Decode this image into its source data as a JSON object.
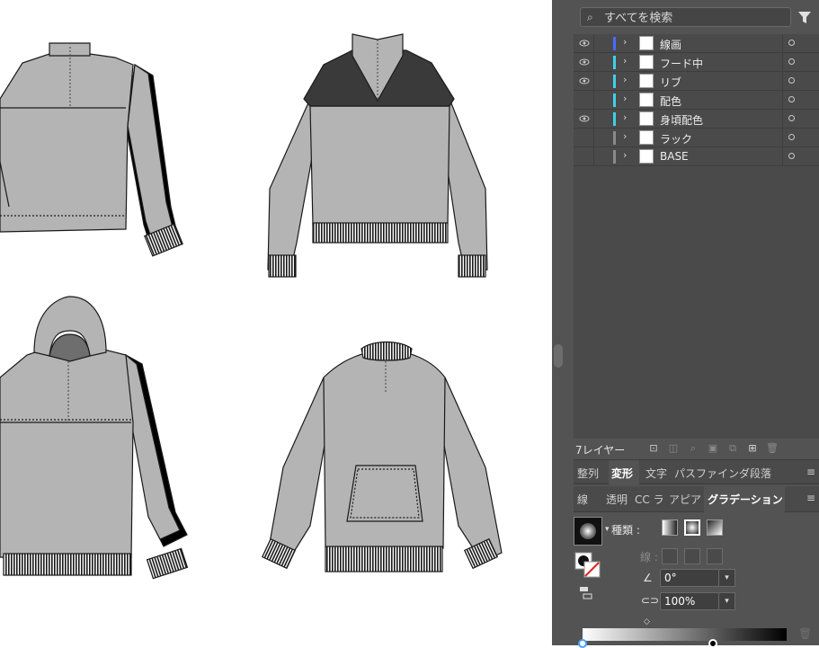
{
  "layers_panel": {
    "search_placeholder": "すべてを検索",
    "search_icon": "magnifier-icon",
    "filter_icon": "filter-funnel-icon",
    "layers": [
      {
        "name": "線画",
        "visible": true,
        "color": "#4a6bff"
      },
      {
        "name": "フード中",
        "visible": true,
        "color": "#3fd0e6"
      },
      {
        "name": "リブ",
        "visible": true,
        "color": "#3fd0e6"
      },
      {
        "name": "配色",
        "visible": false,
        "color": "#3fd0e6"
      },
      {
        "name": "身頃配色",
        "visible": true,
        "color": "#3fd0e6"
      },
      {
        "name": "ラック",
        "visible": false,
        "color": "#8a8a8a"
      },
      {
        "name": "BASE",
        "visible": false,
        "color": "#8a8a8a"
      }
    ],
    "layer_count": "7レイヤー"
  },
  "tabs_row1": [
    {
      "label": "整列",
      "active": false
    },
    {
      "label": "変形",
      "active": true
    },
    {
      "label": "文字",
      "active": false
    },
    {
      "label": "パスファインダ",
      "active": false
    },
    {
      "label": "段落",
      "active": false
    }
  ],
  "tabs_row2": [
    {
      "label": "線",
      "active": false
    },
    {
      "label": "透明",
      "active": false
    },
    {
      "label": "CC ラ",
      "active": false
    },
    {
      "label": "アピア",
      "active": false
    },
    {
      "label": "グラデーション",
      "active": true
    }
  ],
  "gradient": {
    "type_label": "種類 :",
    "stroke_label": "線 :",
    "angle_value": "0°",
    "aspect_value": "100%"
  },
  "colors": {
    "garment_fill": "#b4b4b4",
    "garment_dark": "#3a3a3a",
    "panel_bg": "#535353"
  }
}
